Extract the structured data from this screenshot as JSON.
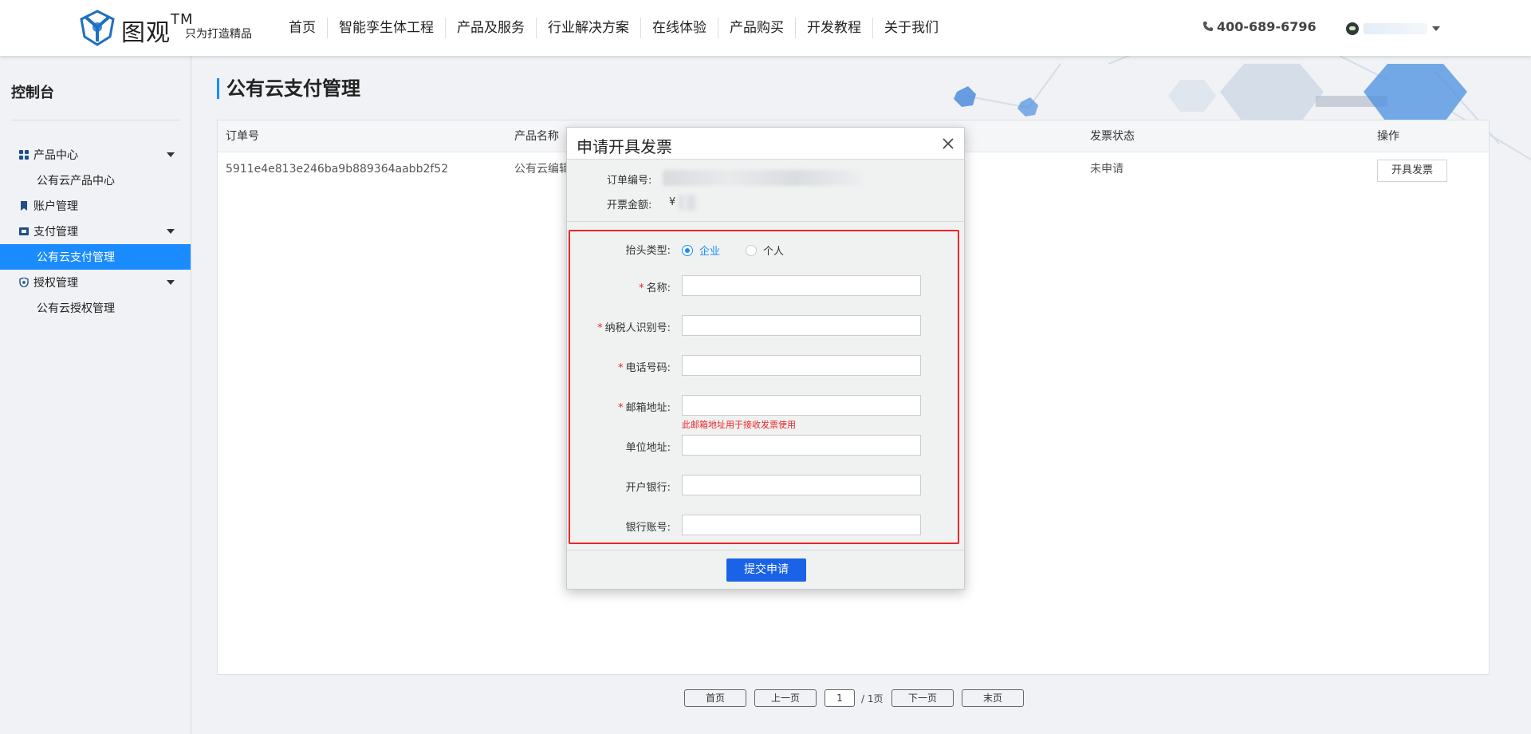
{
  "header": {
    "brand": "图观",
    "brand_tm": "TM",
    "slogan": "只为打造精品",
    "nav": [
      "首页",
      "智能孪生体工程",
      "产品及服务",
      "行业解决方案",
      "在线体验",
      "产品购买",
      "开发教程",
      "关于我们"
    ],
    "phone": "400-689-6796"
  },
  "sidebar": {
    "title": "控制台",
    "items": [
      {
        "label": "产品中心",
        "type": "parent",
        "icon": "grid-icon"
      },
      {
        "label": "公有云产品中心",
        "type": "child"
      },
      {
        "label": "账户管理",
        "type": "parent",
        "icon": "bookmark-icon"
      },
      {
        "label": "支付管理",
        "type": "parent",
        "icon": "ticket-icon"
      },
      {
        "label": "公有云支付管理",
        "type": "child",
        "active": true
      },
      {
        "label": "授权管理",
        "type": "parent",
        "icon": "shield-icon"
      },
      {
        "label": "公有云授权管理",
        "type": "child"
      }
    ]
  },
  "page": {
    "title": "公有云支付管理"
  },
  "table": {
    "columns": [
      "订单号",
      "产品名称",
      "发票状态",
      "操作"
    ],
    "rows": [
      {
        "order_no": "5911e4e813e246ba9b889364aabb2f52",
        "product": "公有云编辑",
        "invoice_status": "未申请",
        "action": "开具发票"
      }
    ]
  },
  "pagination": {
    "first": "首页",
    "prev": "上一页",
    "current": "1",
    "total": "/ 1页",
    "next": "下一页",
    "last": "末页"
  },
  "modal": {
    "title": "申请开具发票",
    "order_label": "订单编号:",
    "amount_label": "开票金额:",
    "amount_prefix": "¥",
    "header_type_label": "抬头类型:",
    "header_types": [
      "企业",
      "个人"
    ],
    "selected_type": "企业",
    "fields": [
      {
        "label": "名称:",
        "required": true,
        "value": ""
      },
      {
        "label": "纳税人识别号:",
        "required": true,
        "value": ""
      },
      {
        "label": "电话号码:",
        "required": true,
        "value": ""
      },
      {
        "label": "邮箱地址:",
        "required": true,
        "value": "",
        "hint": "此邮箱地址用于接收发票使用"
      },
      {
        "label": "单位地址:",
        "required": false,
        "value": ""
      },
      {
        "label": "开户银行:",
        "required": false,
        "value": ""
      },
      {
        "label": "银行账号:",
        "required": false,
        "value": ""
      }
    ],
    "required_mark": "*",
    "submit_label": "提交申请"
  },
  "colors": {
    "accent": "#1a8cff",
    "submit": "#1a62e6",
    "error": "#e8262b"
  }
}
